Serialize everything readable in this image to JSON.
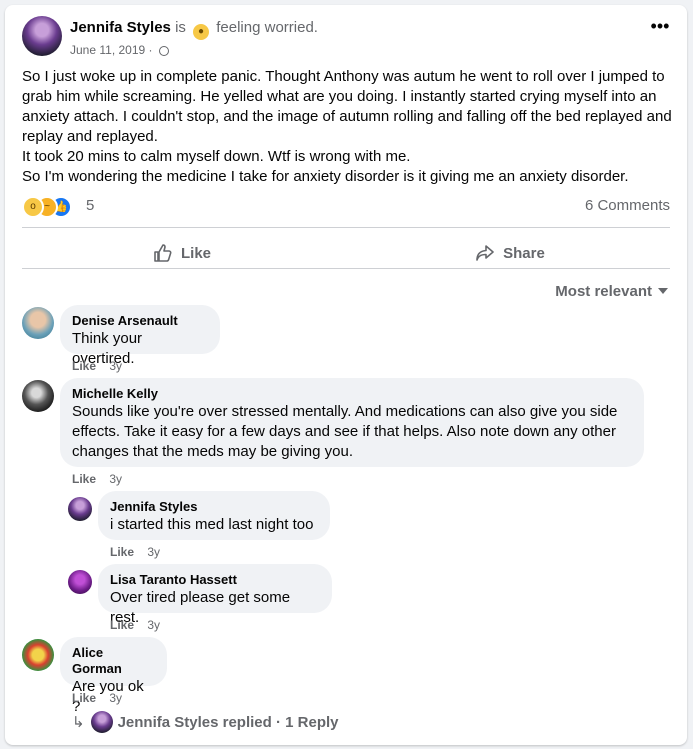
{
  "post": {
    "author": "Jennifa Styles",
    "feeling_prefix": "is",
    "feeling_text": "feeling worried.",
    "date": "June 11, 2019 ·",
    "body": [
      "So I just woke up in complete panic. Thought Anthony was autum he went to roll over I jumped to grab him while screaming. He yelled what are you doing. I instantly started crying myself into an anxiety attach. I couldn't stop, and the image of autumn rolling and falling off the bed replayed and replay and replayed.",
      "It took 20 mins to calm myself down. Wtf is wrong with me.",
      "So I'm wondering the medicine I take for anxiety disorder is it giving me an anxiety disorder."
    ],
    "reaction_count": "5",
    "comments_count": "6 Comments"
  },
  "actions": {
    "like": "Like",
    "share": "Share"
  },
  "sort_label": "Most relevant",
  "comments": [
    {
      "name": "Denise Arsenault",
      "text": "Think your overtired.",
      "like": "Like",
      "time": "3y"
    },
    {
      "name": "Michelle Kelly",
      "text": "Sounds like you're over stressed mentally. And medications can also give you side effects. Take it easy for a few days and see if that helps. Also note down any other changes that the meds may be giving you.",
      "like": "Like",
      "time": "3y"
    },
    {
      "name": "Jennifa Styles",
      "text": "i started this med last night too",
      "like": "Like",
      "time": "3y"
    },
    {
      "name": "Lisa Taranto Hassett",
      "text": "Over tired please get some rest.",
      "like": "Like",
      "time": "3y"
    },
    {
      "name": "Alice Gorman",
      "text": "Are you ok ?",
      "like": "Like",
      "time": "3y"
    }
  ],
  "reply_summary": "Jennifa Styles replied · 1 Reply",
  "reply_arrow": "↳"
}
